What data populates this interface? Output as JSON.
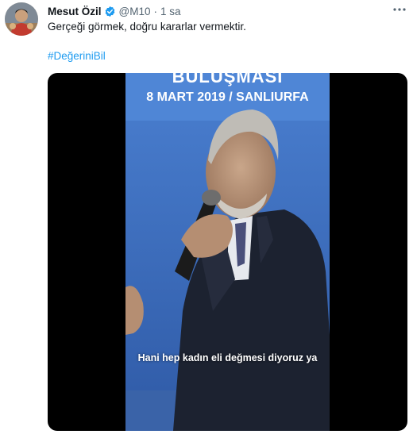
{
  "author": {
    "display_name": "Mesut Özil",
    "handle": "@M10",
    "time": "1 sa",
    "verified_icon": "verified-badge-icon"
  },
  "tweet": {
    "text": "Gerçeği görmek, doğru kararlar vermektir.",
    "hashtag": "#DeğeriniBil"
  },
  "video": {
    "event_title_partial": "BULUŞMASI",
    "event_date_location": "8 MART 2019 / SANLIURFA",
    "subtitle": "Hani hep kadın eli değmesi diyoruz ya"
  },
  "colors": {
    "accent": "#1d9bf0",
    "text": "#0f1419",
    "secondary": "#536471",
    "stage_blue": "#3f6fc4"
  },
  "icons": {
    "more": "more-horizontal-icon"
  }
}
